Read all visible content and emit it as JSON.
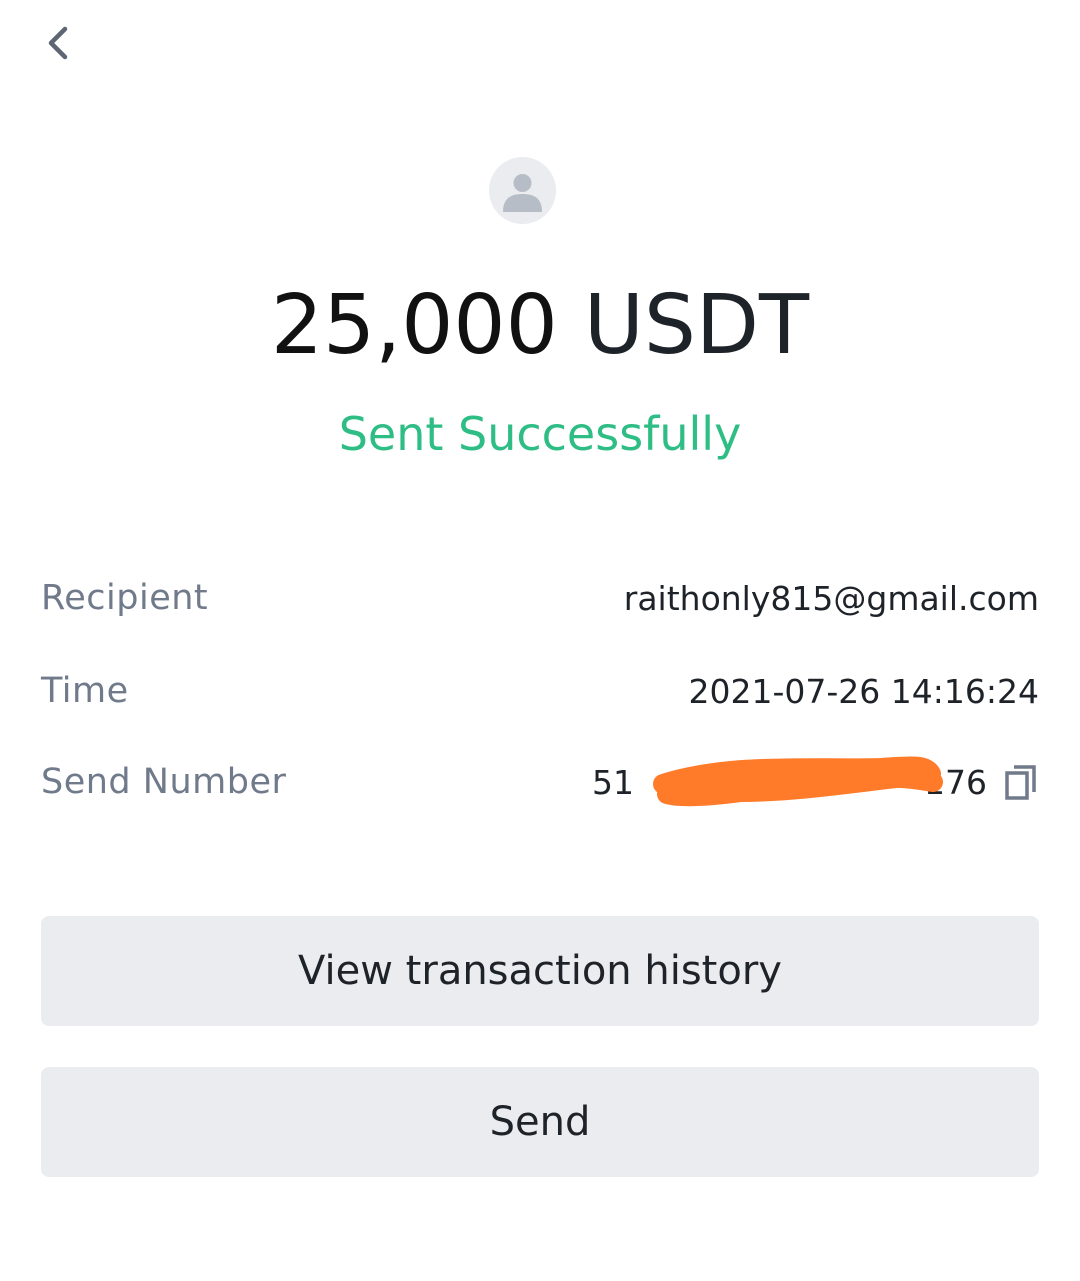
{
  "header": {
    "back_icon": "chevron-left-icon"
  },
  "avatar": {
    "icon": "user-silhouette-icon"
  },
  "transfer": {
    "amount": "25,000",
    "currency": "USDT",
    "status": "Sent Successfully"
  },
  "details": {
    "recipient": {
      "label": "Recipient",
      "value": "raithonly815@gmail.com"
    },
    "time": {
      "label": "Time",
      "value": "2021-07-26 14:16:24"
    },
    "send_number": {
      "label": "Send Number",
      "value_prefix": "51",
      "value_suffix": "176",
      "copy_icon": "copy-icon"
    }
  },
  "actions": {
    "view_history_label": "View transaction history",
    "send_label": "Send"
  },
  "colors": {
    "success": "#2ebd85",
    "label": "#707a8a",
    "text": "#1e2329",
    "button_bg": "#eaecef",
    "redaction": "#ff7a29"
  }
}
